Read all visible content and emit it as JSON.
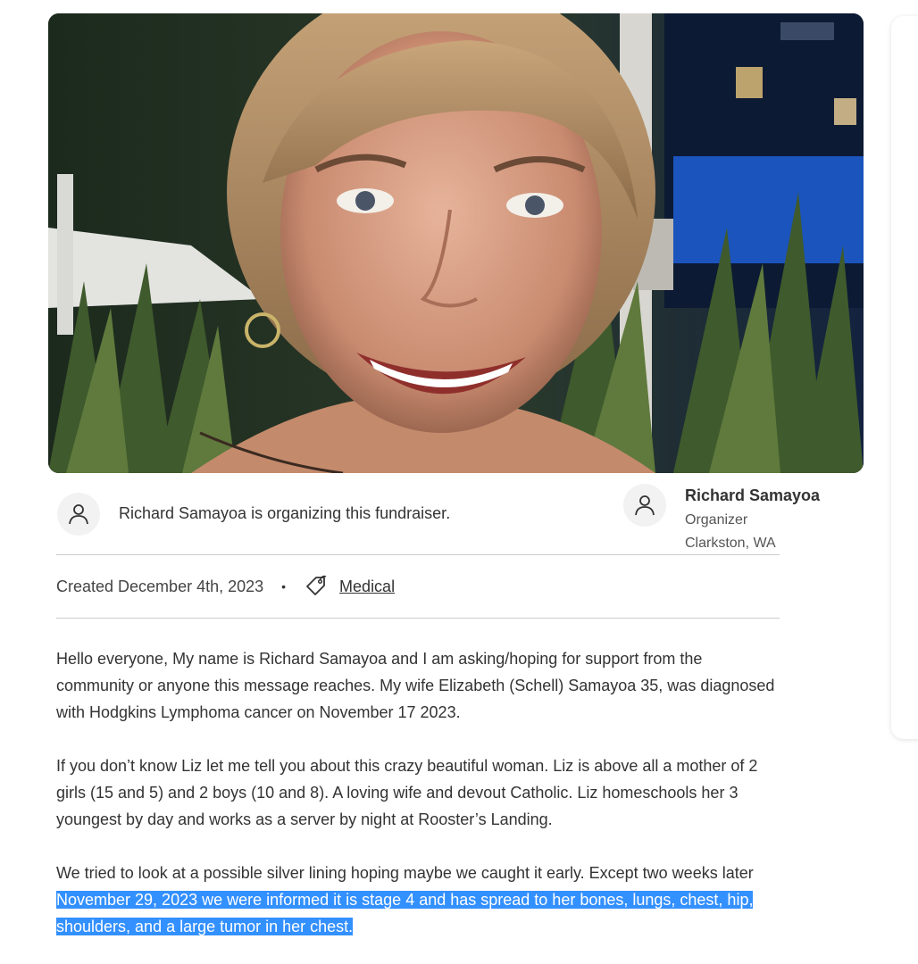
{
  "organizer_line": "Richard Samayoa is organizing this fundraiser.",
  "organizer": {
    "name": "Richard Samayoa",
    "role": "Organizer",
    "location": "Clarkston, WA"
  },
  "meta": {
    "created": "Created December 4th, 2023",
    "separator": "•",
    "category": "Medical"
  },
  "story": {
    "p1": "Hello everyone, My name is Richard Samayoa and I am asking/hoping for support from the community or anyone this message reaches. My wife Elizabeth (Schell) Samayoa 35, was diagnosed with Hodgkins Lymphoma cancer on November 17 2023.",
    "p2": "If you don’t know Liz let me tell you about this crazy beautiful woman. Liz is above all a mother of 2 girls (15 and 5) and 2 boys (10 and 8). A loving wife and devout Catholic. Liz homeschools her 3 youngest by day and works as a server by night at Rooster’s Landing.",
    "p3_plain": "We tried to look at a possible silver lining hoping maybe we caught it early. Except two weeks later ",
    "p3_highlighted": "November 29, 2023 we were informed it is stage 4 and has spread to her bones, lungs, chest, hip, shoulders, and a large tumor in her chest."
  },
  "icons": {
    "avatar": "person-icon",
    "category": "tag-icon"
  },
  "colors": {
    "highlight": "#3390ff",
    "rule": "#cccccc",
    "avatar_bg": "#f2f2f2"
  }
}
